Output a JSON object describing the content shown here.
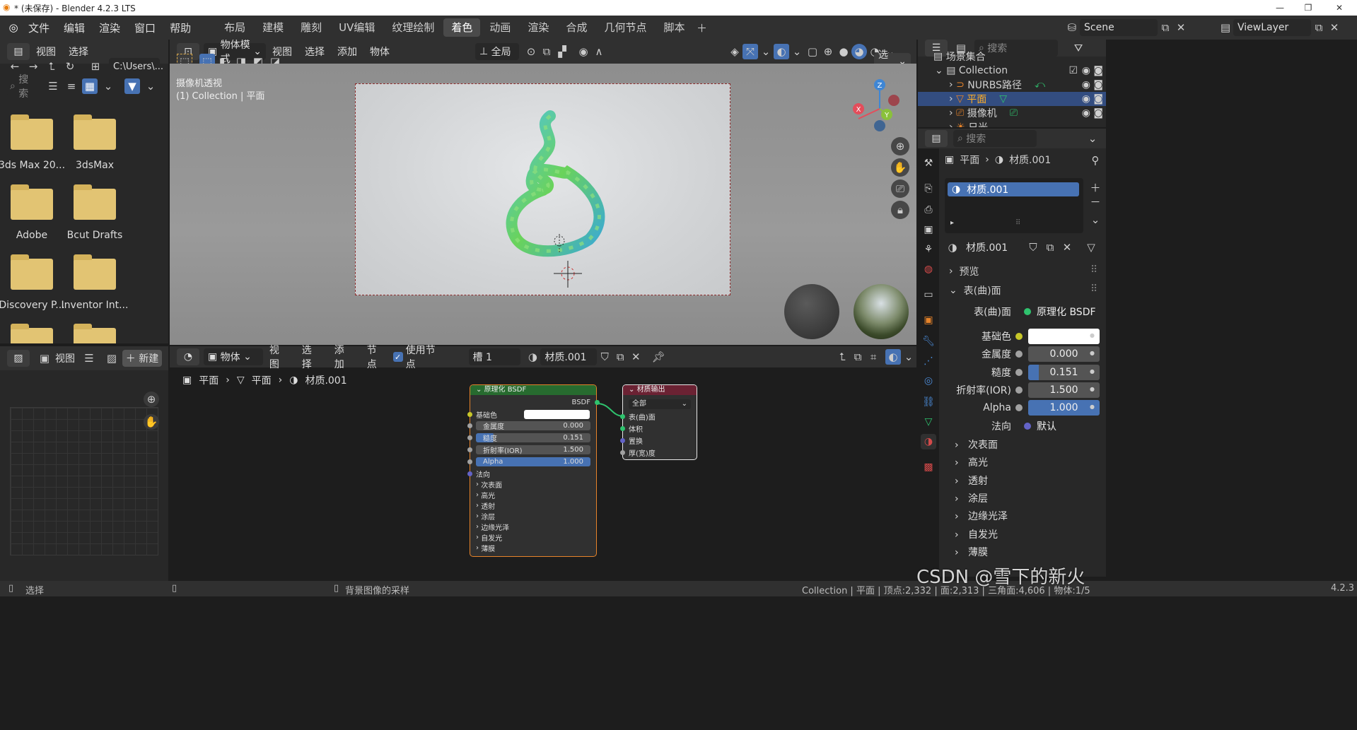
{
  "title": "* (未保存) - Blender 4.2.3 LTS",
  "menu": [
    "文件",
    "编辑",
    "渲染",
    "窗口",
    "帮助"
  ],
  "workspaces": [
    "布局",
    "建模",
    "雕刻",
    "UV编辑",
    "纹理绘制",
    "着色",
    "动画",
    "渲染",
    "合成",
    "几何节点",
    "脚本"
  ],
  "active_workspace": "着色",
  "scene": {
    "label": "Scene",
    "view_layer": "ViewLayer"
  },
  "file_browser": {
    "menu": [
      "视图",
      "选择"
    ],
    "path": "C:\\Users\\...",
    "search_placeholder": "搜索",
    "folders": [
      "3ds Max 20...",
      "3dsMax",
      "Adobe",
      "Bcut Drafts",
      "Discovery P...",
      "Inventor Int..."
    ]
  },
  "image_editor": {
    "view": "视图",
    "new": "新建"
  },
  "viewport": {
    "mode": "物体模式",
    "menu": [
      "视图",
      "选择",
      "添加",
      "物体"
    ],
    "transform": "全局",
    "options": "选项",
    "overlay_line1": "摄像机透视",
    "overlay_line2": "(1) Collection | 平面",
    "gizmo": {
      "x": "X",
      "y": "Y",
      "z": "Z"
    },
    "colors": {
      "x": "#e44d5b",
      "y": "#8ac13b",
      "z": "#3f86d4"
    }
  },
  "node_editor": {
    "type": "物体",
    "menu": [
      "视图",
      "选择",
      "添加",
      "节点"
    ],
    "use_nodes": "使用节点",
    "slot": "槽 1",
    "material": "材质.001",
    "breadcrumb": [
      "平面",
      "平面",
      "材质.001"
    ],
    "bsdf_node": {
      "title": "原理化 BSDF",
      "output": "BSDF",
      "rows": [
        {
          "label": "基础色",
          "value": ""
        },
        {
          "label": "金属度",
          "value": "0.000"
        },
        {
          "label": "糙度",
          "value": "0.151"
        },
        {
          "label": "折射率(IOR)",
          "value": "1.500"
        },
        {
          "label": "Alpha",
          "value": "1.000"
        }
      ],
      "normal": "法向",
      "panels": [
        "次表面",
        "高光",
        "透射",
        "涂层",
        "边缘光泽",
        "自发光",
        "薄膜"
      ]
    },
    "output_node": {
      "title": "材质输出",
      "target": "全部",
      "inputs": [
        "表(曲)面",
        "体积",
        "置换",
        "厚(宽)度"
      ]
    }
  },
  "outliner": {
    "search_placeholder": "搜索",
    "root": "场景集合",
    "collection": "Collection",
    "items": [
      "NURBS路径",
      "平面",
      "摄像机",
      "日光"
    ]
  },
  "properties": {
    "search_placeholder": "搜索",
    "breadcrumb_object": "平面",
    "breadcrumb_material": "材质.001",
    "slot_item": "材质.001",
    "material_name": "材质.001",
    "panel_preview": "预览",
    "panel_surface": "表(曲)面",
    "surface_label": "表(曲)面",
    "surface_value": "原理化 BSDF",
    "fields": [
      {
        "label": "基础色",
        "value": ""
      },
      {
        "label": "金属度",
        "value": "0.000"
      },
      {
        "label": "糙度",
        "value": "0.151"
      },
      {
        "label": "折射率(IOR)",
        "value": "1.500"
      },
      {
        "label": "Alpha",
        "value": "1.000"
      }
    ],
    "normal_label": "法向",
    "normal_value": "默认",
    "subpanels": [
      "次表面",
      "高光",
      "透射",
      "涂层",
      "边缘光泽",
      "自发光",
      "薄膜"
    ]
  },
  "statusbar": {
    "left": "选择",
    "middle": "背景图像的采样",
    "stats": "Collection | 平面 | 顶点:2,332 | 面:2,313 | 三角面:4,606 | 物体:1/5",
    "version": "4.2.3"
  },
  "watermark": "CSDN @雪下的新火"
}
